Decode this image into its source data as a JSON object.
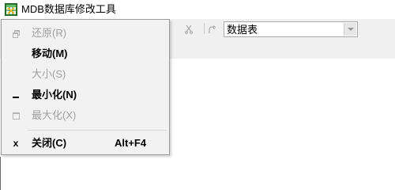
{
  "window": {
    "title": "MDB数据库修改工具",
    "icon": "excel-like-app-icon"
  },
  "toolbar": {
    "cut_icon": "cut-icon",
    "redo_icon": "redo-icon",
    "table_combo": {
      "value": "数据表"
    }
  },
  "system_menu": {
    "items": [
      {
        "label": "还原(R)",
        "icon": "restore-icon",
        "enabled": false
      },
      {
        "label": "移动(M)",
        "icon": "",
        "enabled": true
      },
      {
        "label": "大小(S)",
        "icon": "",
        "enabled": false
      },
      {
        "label": "最小化(N)",
        "icon": "minimize-icon",
        "enabled": true
      },
      {
        "label": "最大化(X)",
        "icon": "maximize-icon",
        "enabled": false
      },
      {
        "label": "关闭(C)",
        "icon": "close-icon",
        "enabled": true,
        "shortcut": "Alt+F4"
      }
    ]
  },
  "colors": {
    "menu_bg": "#f2f2f2",
    "disabled_text": "#a0a0a0",
    "window_bg": "#ffffff"
  }
}
